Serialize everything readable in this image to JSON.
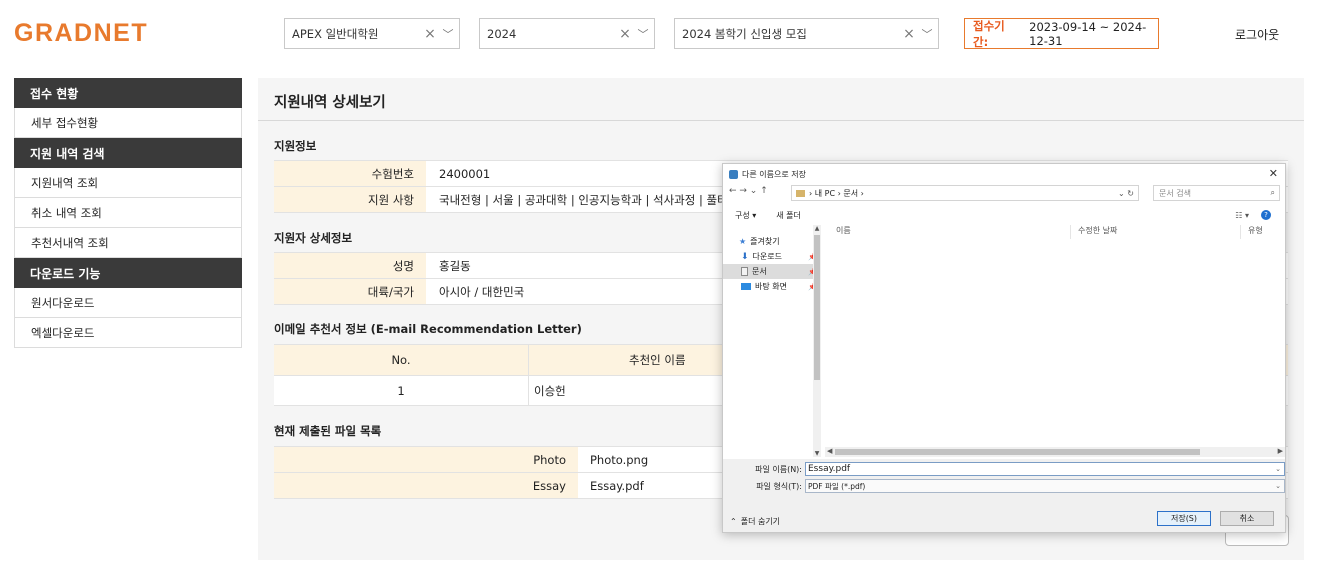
{
  "header": {
    "logo": "GRADNET",
    "university": "APEX 일반대학원",
    "year": "2024",
    "recruitment": "2024 봄학기 신입생 모집",
    "clear_icon": "×",
    "dropdown_icon": "﹀",
    "period_label": "접수기간:",
    "period_value": "2023-09-14 ~ 2024-12-31",
    "logout": "로그아웃",
    "accent_color": "#e87a2d"
  },
  "sidebar": {
    "sections": [
      {
        "title": "접수 현황",
        "items": [
          "세부 접수현황"
        ]
      },
      {
        "title": "지원 내역 검색",
        "items": [
          "지원내역 조회",
          "취소 내역 조회",
          "추천서내역 조회"
        ]
      },
      {
        "title": "다운로드 기능",
        "items": [
          "원서다운로드",
          "엑셀다운로드"
        ]
      }
    ]
  },
  "main": {
    "title": "지원내역 상세보기",
    "applicant_info": {
      "title": "지원정보",
      "rows": [
        {
          "key": "수험번호",
          "value": "2400001"
        },
        {
          "key": "지원 사항",
          "value": "국내전형 | 서울 | 공과대학 | 인공지능학과 | 석사과정 | 풀타임"
        }
      ]
    },
    "applicant_detail": {
      "title": "지원자 상세정보",
      "rows": [
        {
          "key": "성명",
          "value": "홍길동"
        },
        {
          "key": "대륙/국가",
          "value": "아시아 / 대한민국"
        }
      ]
    },
    "recommendation": {
      "title": "이메일 추천서 정보 (E-mail Recommendation Letter)",
      "headers": [
        "No.",
        "추천인 이름"
      ],
      "rows": [
        [
          "1",
          "이승헌"
        ]
      ]
    },
    "files": {
      "title": "현재 제출된 파일 목록",
      "rows": [
        {
          "key": "Photo",
          "value": "Photo.png"
        },
        {
          "key": "Essay",
          "value": "Essay.pdf"
        }
      ]
    }
  },
  "dialog": {
    "title": "다른 이름으로 저장",
    "close": "✕",
    "nav_icons": "←  →  ⌄  ↑",
    "breadcrumb": "› 내 PC › 문서 ›",
    "breadcrumb_tail": "⌄  ↻",
    "search_placeholder": "문서 검색",
    "search_icon": "⌕",
    "toolbar": {
      "organize": "구성 ▾",
      "new_folder": "새 폴더",
      "view": "☷ ▾",
      "help": "?"
    },
    "tree": [
      {
        "label": "즐겨찾기",
        "icon": "star-icon"
      },
      {
        "label": "다운로드",
        "icon": "download-icon",
        "pinned": true
      },
      {
        "label": "문서",
        "icon": "document-icon",
        "pinned": true,
        "selected": true
      },
      {
        "label": "바탕 화면",
        "icon": "desktop-icon",
        "pinned": true
      }
    ],
    "pin_glyph": "📌",
    "columns": [
      "이름",
      "수정한 날짜",
      "유형"
    ],
    "file_name_label": "파일 이름(N):",
    "file_name_value": "Essay.pdf",
    "file_type_label": "파일 형식(T):",
    "file_type_value": "PDF 파일 (*.pdf)",
    "hide_folders": "폴더 숨기기",
    "save_button": "저장(S)",
    "cancel_button": "취소"
  }
}
